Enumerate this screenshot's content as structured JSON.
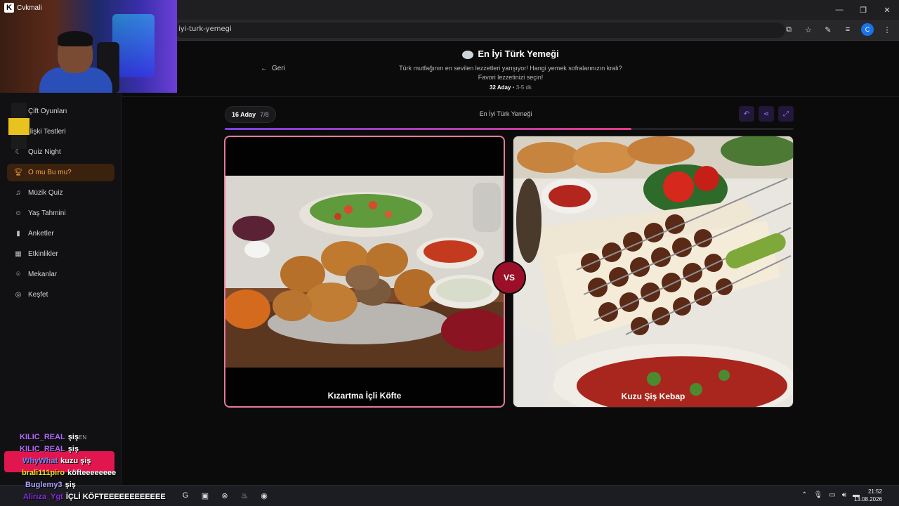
{
  "browser": {
    "tab_title": "Cvkmali",
    "url": "iyi-turk-yemegi",
    "profile_initial": "C"
  },
  "sidebar": {
    "items": [
      {
        "label": "Çift Oyunları",
        "icon": "heart-icon",
        "active": false
      },
      {
        "label": "İlişki Testleri",
        "icon": "heart-pulse-icon",
        "active": false
      },
      {
        "label": "Quiz Night",
        "icon": "moon-icon",
        "active": false
      },
      {
        "label": "O mu Bu mu?",
        "icon": "trophy-icon",
        "active": true
      },
      {
        "label": "Müzik Quiz",
        "icon": "headphones-icon",
        "active": false
      },
      {
        "label": "Yaş Tahmini",
        "icon": "users-icon",
        "active": false
      },
      {
        "label": "Anketler",
        "icon": "bar-chart-icon",
        "active": false
      },
      {
        "label": "Etkinlikler",
        "icon": "calendar-icon",
        "active": false
      },
      {
        "label": "Mekanlar",
        "icon": "map-pin-icon",
        "active": false
      },
      {
        "label": "Keşfet",
        "icon": "compass-icon",
        "active": false
      }
    ],
    "lang": "EN"
  },
  "header": {
    "back_label": "Geri",
    "title": "En İyi Türk Yemeği",
    "subtitle_line1": "Türk mutfağının en sevilen lezzetleri yarışıyor! Hangi yemek sofralarınızın kralı?",
    "subtitle_line2": "Favori lezzetinizi seçin!",
    "candidates": "32 Aday",
    "duration": "3-5 dk"
  },
  "round": {
    "count_label": "16 Aday",
    "progress_label": "7/8",
    "progress": 0.715,
    "title": "En İyi Türk Yemeği"
  },
  "matchup": {
    "left_label": "Kızartma İçli Köfte",
    "right_label": "Kuzu Şiş Kebap",
    "vs": "VS"
  },
  "taskbar": {
    "time": "21:52",
    "date": "13.08.2026"
  },
  "chat": [
    {
      "user": "KILIC_REAL",
      "msg": "şiş",
      "color": "#b26bff"
    },
    {
      "user": "KILIC_REAL",
      "msg": "şiş",
      "color": "#b26bff"
    },
    {
      "user": "WhyWhat",
      "msg": "kuzu şiş",
      "color": "#6b8cff"
    },
    {
      "user": "brali111piro",
      "msg": "köfteeeeeeee",
      "color": "#f0e020"
    },
    {
      "user": "Buglemy3",
      "msg": "şiş",
      "color": "#a7a1ff"
    },
    {
      "user": "Alirıza_Ygt",
      "msg": "İÇLİ KÖFTEEEEEEEEEEEE",
      "color": "#8a2be2"
    }
  ],
  "colors": {
    "accent": "#f5a442",
    "vs_bg": "#9b1028",
    "progress_start": "#7b3fe4",
    "progress_end": "#e23b88"
  }
}
